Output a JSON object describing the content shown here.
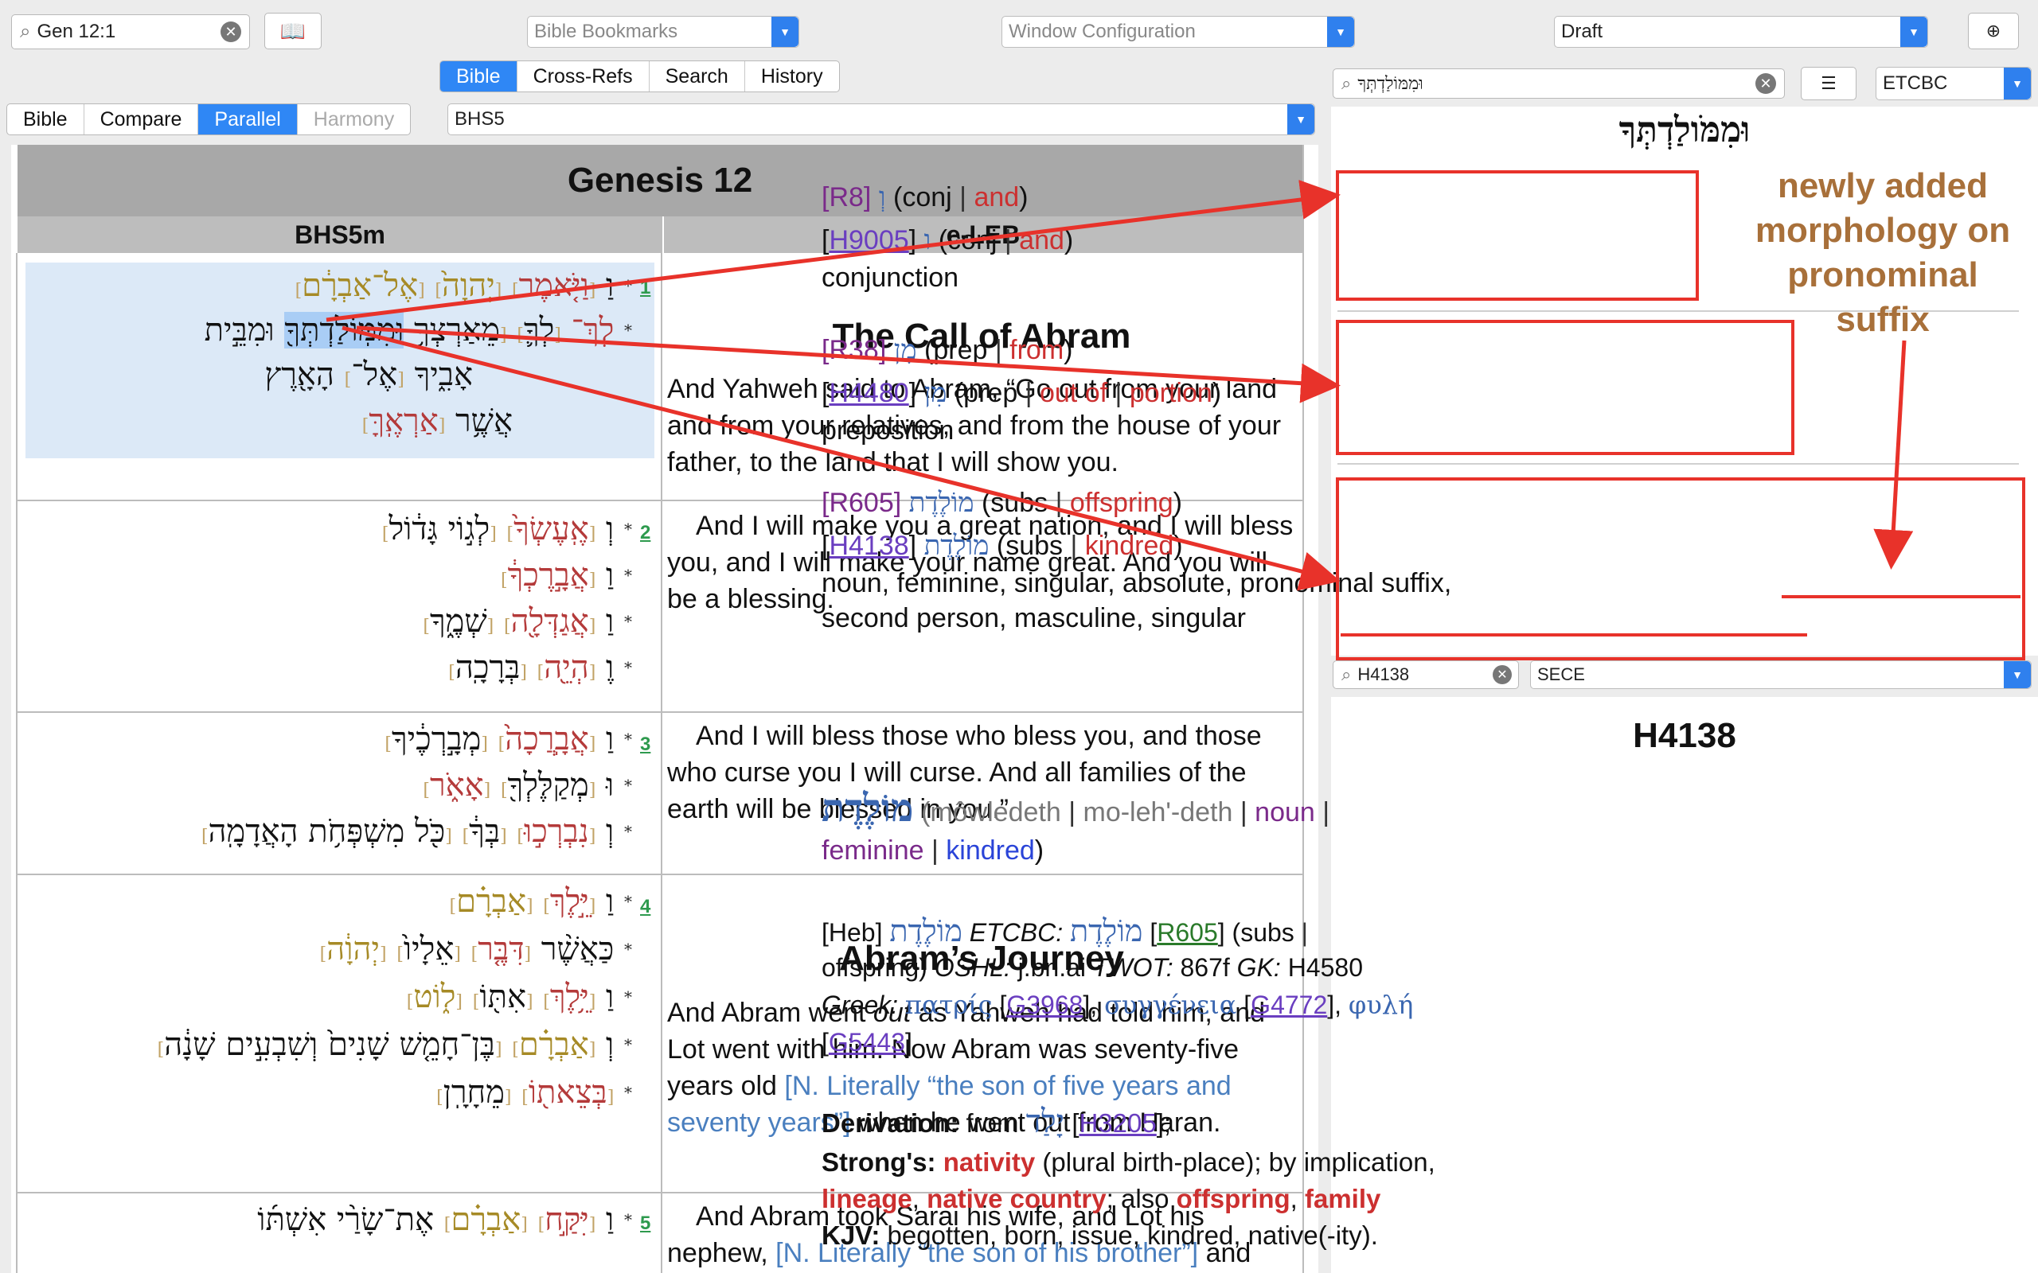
{
  "toolbar": {
    "search_value": "Gen 12:1",
    "bookmarks": "Bible Bookmarks",
    "window_config": "Window Configuration",
    "draft": "Draft"
  },
  "tabs": [
    "Bible",
    "Cross-Refs",
    "Search",
    "History"
  ],
  "views": [
    "Bible",
    "Compare",
    "Parallel",
    "Harmony"
  ],
  "module": "BHS5",
  "table": {
    "title": "Genesis 12",
    "col1": "BHS5m",
    "col2": "e-LEB"
  },
  "hebrew": {
    "v1": [
      "אֶל־אַבְרָ֔ם",
      "יְהוָה֙",
      "וַיֹּ֤אמֶר",
      "וַ",
      "לֶךְ־",
      "לְךָ֛",
      "מֵאַרְצְךָ֥",
      "וּמִמּֽוֹלַדְתְּךָ֖",
      "וּמִבֵּ֣ית",
      "אָבִ֑יךָ",
      "אֶל־",
      "הָאָ֖רֶץ",
      "אֲשֶׁ֥ר",
      "אַרְאֶֽךָּ"
    ],
    "v2": [
      "לְג֣וֹי גָּד֔וֹל",
      "אֶֽעֶשְׂךָ֙",
      "וְ",
      "אֲבָ֣רֶכְךָ֔",
      "וַ",
      "אֲגַדְּלָ֖ה",
      "וַ",
      "שְׁמֶ֑ךָ",
      "הְיֵ֖ה",
      "וֶ",
      "בְּרָכָֽה"
    ],
    "v3": [
      "מְבָ֣רְכֶ֔יךָ",
      "אֲבָֽרֲכָה֙",
      "וַ",
      "אָאֹ֑ר",
      "מְקַלֶּלְךָ֖",
      "וּ",
      "כֹּ֖ל מִשְׁפְּחֹ֥ת הָאֲדָמָֽה",
      "בְּךָ֔",
      "נִבְרְכ֣וּ",
      "וְ"
    ],
    "v4": [
      "אַבְרָ֗ם",
      "יֵּ֣לֶךְ",
      "וַ",
      "יְהוָ֔ה",
      "אֵלָיו֙",
      "דִּבֶּ֤ר",
      "כַּאֲשֶׁ֨ר",
      "ל֑וֹט",
      "אִתּ֖וֹ",
      "יֵּ֥לֶךְ",
      "וַ",
      "בֶּן־חָמֵ֤שׁ שָׁנִים֙ וְשִׁבְעִ֣ים שָׁנָ֔ה",
      "אַבְרָ֗ם",
      "וְ",
      "מֵחָרָֽן",
      "בְּצֵאת֖וֹ"
    ],
    "v5": [
      "אֶת־שָׂרַ֨י אִשְׁתּ֜וֹ",
      "אַבְרָ֗ם",
      "יִּקַּ֣ח",
      "וַ"
    ]
  },
  "english": {
    "heading1": "The Call of Abram",
    "v1": "And Yahweh said to Abram, “Go out from your land and from your relatives, and from the house of your father, to the land that I will show you.",
    "v2": "And I will make you a great nation, and I will bless you, and I will make your name great. And you will be a blessing.",
    "v3": "And I will bless those who bless you, and those who curse you I will curse. And all families of the earth will be blessed in you.”",
    "heading2": "Abram’s Journey",
    "v4a": "And Abram went ",
    "v4b": "out",
    "v4c": " as Yahweh had told him, and Lot went with him. Now Abram ",
    "v4d": "was seventy-five years old ",
    "v4fn": "[N. Literally “the son of five years and seventy years”]",
    "v4e": " when he went out from Haran.",
    "v5a": "And Abram took Sarai his wife, and Lot ",
    "v5b": "his nephew, ",
    "v5fn": "[N. Literally “the son of his brother”]",
    "v5c": " and"
  },
  "verse_nums": [
    "1",
    "2",
    "3",
    "4",
    "5"
  ],
  "right_top": {
    "search": "וּמִמּוֹלַדְתְּךָ",
    "module": "ETCBC",
    "title": "וּמִמֹּולַדְתְּךָ"
  },
  "morph": [
    {
      "ref": "R8",
      "heb": "וְ",
      "pos": "conj",
      "gloss": "and"
    },
    {
      "ref": "H9005",
      "heb": "ו",
      "pos": "conj",
      "gloss": "and"
    },
    {
      "desc": "conjunction"
    },
    {
      "ref": "R38",
      "heb": "מִן",
      "pos": "prep",
      "gloss": "from"
    },
    {
      "ref": "H4480",
      "heb": "מִן",
      "pos": "prep",
      "gloss": "out of",
      "gloss2": "portion"
    },
    {
      "desc": "preposition"
    },
    {
      "ref": "R605",
      "heb": "מוֹלֶדֶת",
      "pos": "subs",
      "gloss": "offspring"
    },
    {
      "ref": "H4138",
      "heb": "מוֹלֶדֶת",
      "pos": "subs",
      "gloss": "kindred"
    },
    {
      "desc1": "noun, feminine, singular, absolute, pronominal suffix,",
      "desc2": "second person, masculine, singular"
    }
  ],
  "annotation": {
    "l1": "newly added",
    "l2": "morphology on",
    "l3": "pronominal",
    "l4": "suffix",
    "color": "#a8703a"
  },
  "right_bottom": {
    "search": "H4138",
    "module": "SECE",
    "title": "H4138",
    "lemma": "מוֹלֶדֶת",
    "translit": "môwledeth",
    "pron": "mo-leh'-deth",
    "pos": "noun",
    "gender": "feminine",
    "gloss": "kindred",
    "heb_tag": "[Heb]",
    "etcbc_label": "ETCBC:",
    "r605": "R605",
    "subs": "subs",
    "offspring": "offspring",
    "oshl": "OSHL:",
    "oshl_val": "j.bn.ai",
    "twot": "TWOT:",
    "twot_val": "867f",
    "gk": "GK:",
    "gk_val": "H4580",
    "greek_label": "Greek:",
    "g1": "πατρίς",
    "g1r": "G3968",
    "g2": "συγγένεια",
    "g2r": "G4772",
    "g3": "φυλή",
    "g3r": "G5443",
    "deriv_label": "Derivation:",
    "deriv_from": "from",
    "deriv_heb": "יָלַד",
    "deriv_ref": "H3205",
    "strongs_label": "Strong's:",
    "s1": "nativity",
    "s2": "(plural birth-place); by implication,",
    "s3": "lineage",
    "s4": "native country",
    "s5": "; also",
    "s6": "offspring",
    "s7": "family",
    "kjv_label": "KJV:",
    "kjv": "begotten, born, issue, kindred, native(-ity)."
  }
}
